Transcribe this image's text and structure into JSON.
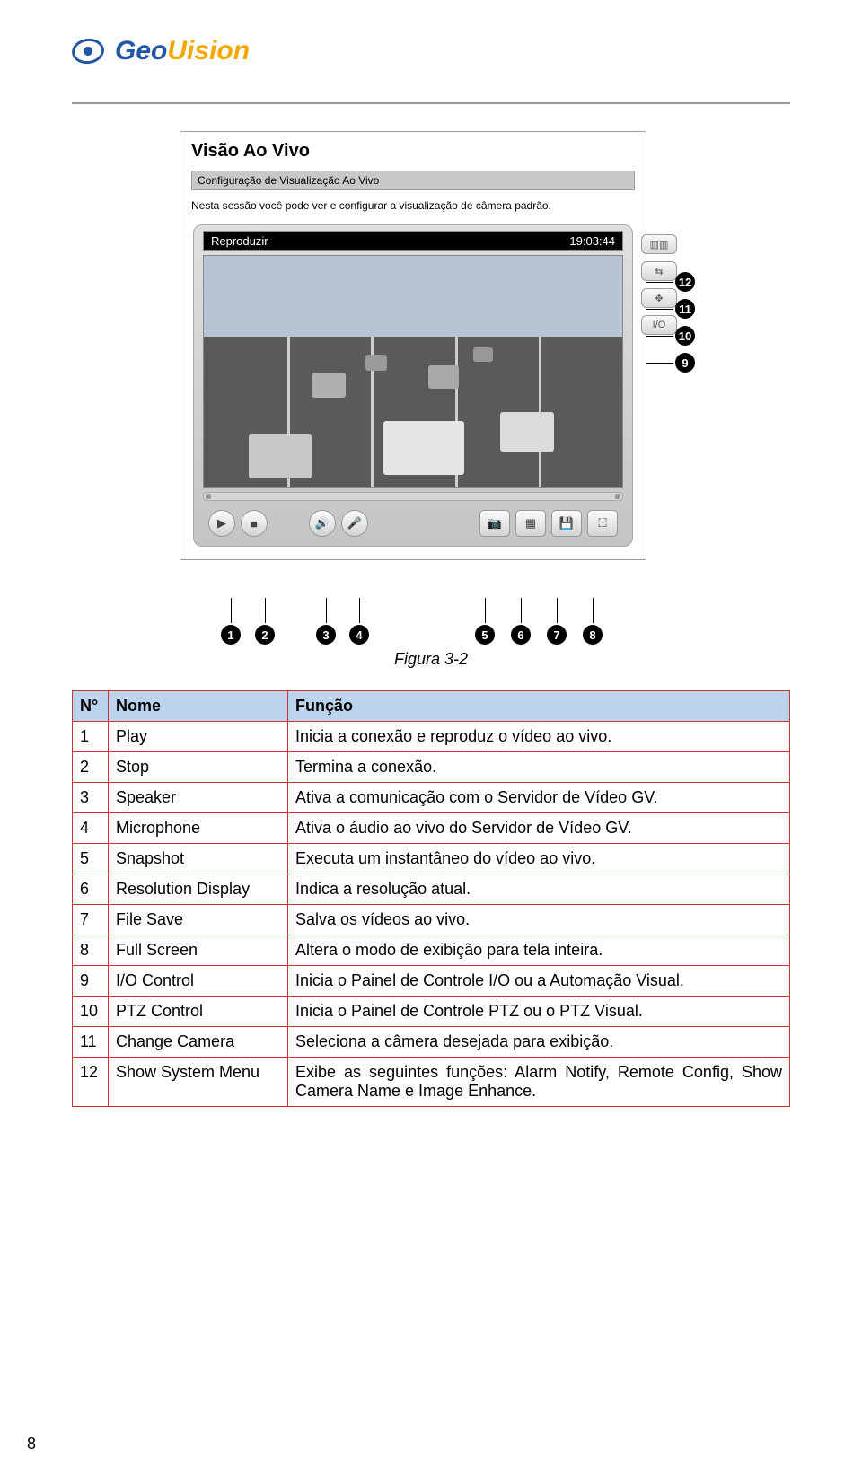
{
  "logo": {
    "part1": "Geo",
    "part2": "Uision"
  },
  "window": {
    "title": "Visão Ao Vivo",
    "subtitle_bar": "Configuração de Visualização Ao Vivo",
    "description": "Nesta sessão você pode ver e configurar a visualização de câmera padrão."
  },
  "player": {
    "label_left": "Reproduzir",
    "label_right": "19:03:44"
  },
  "callouts_side": [
    "12",
    "11",
    "10",
    "9"
  ],
  "callouts_bottom": [
    "1",
    "2",
    "3",
    "4",
    "5",
    "6",
    "7",
    "8"
  ],
  "figure_caption": "Figura 3-2",
  "table": {
    "headers": [
      "N°",
      "Nome",
      "Função"
    ],
    "rows": [
      {
        "n": "1",
        "nome": "Play",
        "func": "Inicia a conexão e reproduz o vídeo ao vivo."
      },
      {
        "n": "2",
        "nome": "Stop",
        "func": "Termina a conexão."
      },
      {
        "n": "3",
        "nome": "Speaker",
        "func": "Ativa a comunicação com o Servidor de Vídeo GV."
      },
      {
        "n": "4",
        "nome": "Microphone",
        "func": "Ativa o áudio ao vivo do Servidor de Vídeo GV."
      },
      {
        "n": "5",
        "nome": "Snapshot",
        "func": "Executa um instantâneo do vídeo ao vivo."
      },
      {
        "n": "6",
        "nome": "Resolution Display",
        "func": "Indica a resolução atual."
      },
      {
        "n": "7",
        "nome": "File Save",
        "func": "Salva os vídeos ao vivo."
      },
      {
        "n": "8",
        "nome": "Full Screen",
        "func": "Altera o modo de exibição para tela inteira."
      },
      {
        "n": "9",
        "nome": "I/O Control",
        "func": "Inicia o Painel de Controle I/O ou a Automação Visual."
      },
      {
        "n": "10",
        "nome": "PTZ Control",
        "func": "Inicia o Painel de Controle PTZ ou o PTZ Visual."
      },
      {
        "n": "11",
        "nome": "Change Camera",
        "func": "Seleciona a câmera desejada para exibição."
      },
      {
        "n": "12",
        "nome": "Show System Menu",
        "func": "Exibe as seguintes funções: Alarm Notify, Remote Config, Show Camera Name e Image Enhance."
      }
    ]
  },
  "page_number": "8"
}
